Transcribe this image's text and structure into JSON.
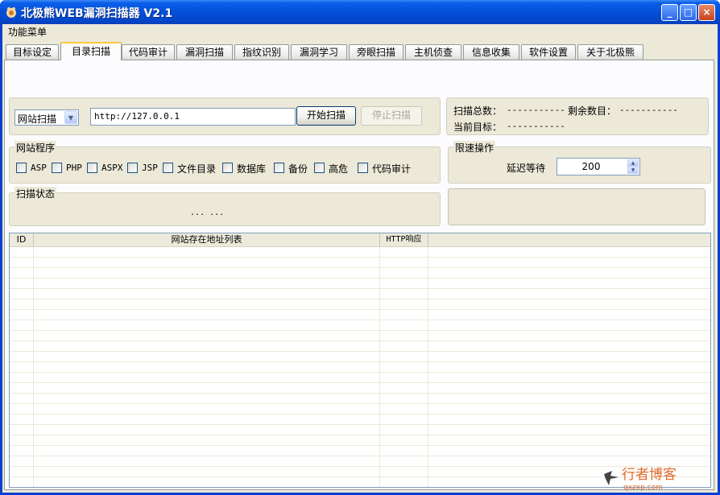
{
  "window": {
    "title": "北极熊WEB漏洞扫描器 V2.1",
    "controls": {
      "minimize": "_",
      "maximize": "□",
      "close": "×"
    }
  },
  "menu": {
    "items": [
      "功能菜单"
    ]
  },
  "tabs": [
    "目标设定",
    "目录扫描",
    "代码审计",
    "漏洞扫描",
    "指纹识别",
    "漏洞学习",
    "旁眼扫描",
    "主机侦查",
    "信息收集",
    "软件设置",
    "关于北极熊"
  ],
  "active_tab": "目录扫描",
  "scan": {
    "mode_select": "网站扫描",
    "url": "http://127.0.0.1",
    "start_button": "开始扫描",
    "stop_button": "停止扫描"
  },
  "stats": {
    "total_label": "扫描总数：",
    "total_value": "-----------",
    "remaining_label": "剩余数目：",
    "remaining_value": "-----------",
    "current_label": "当前目标：",
    "current_value": "-----------"
  },
  "program_group": {
    "legend": "网站程序",
    "options": [
      "ASP",
      "PHP",
      "ASPX",
      "JSP",
      "文件目录",
      "数据库",
      "备份",
      "高危",
      "代码审计"
    ]
  },
  "throttle_group": {
    "legend": "限速操作",
    "delay_label": "延迟等待",
    "delay_value": "200"
  },
  "status_group": {
    "legend": "扫描状态",
    "text": "... ..."
  },
  "table": {
    "columns": [
      "ID",
      "网站存在地址列表",
      "HTTP响应",
      ""
    ],
    "rows": []
  },
  "watermark": {
    "text": "行者博客",
    "url": "qxzxp.com"
  },
  "colors": {
    "titlebar": "#0550d8",
    "face": "#ece9d8",
    "tab_highlight": "#ffc73c",
    "watermark": "#e06a2a"
  }
}
